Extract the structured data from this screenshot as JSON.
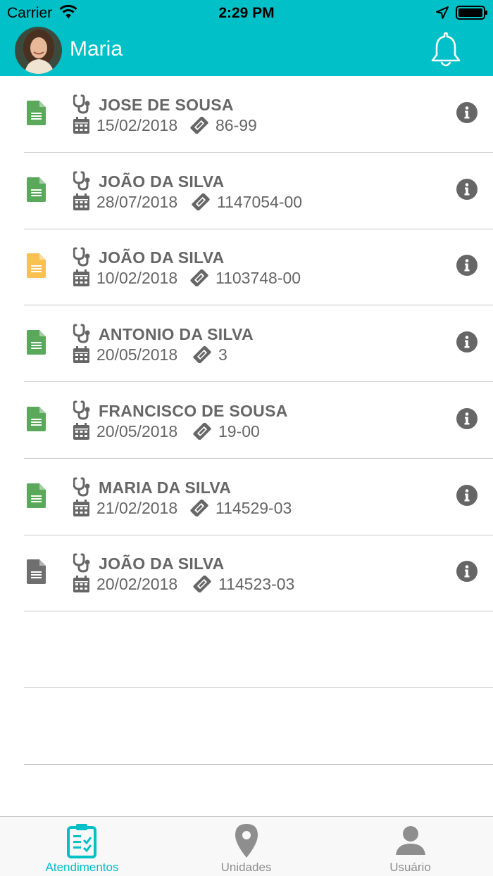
{
  "status_bar": {
    "carrier": "Carrier",
    "time": "2:29 PM"
  },
  "header": {
    "user_name": "Maria"
  },
  "records": [
    {
      "name": "JOSE DE SOUSA",
      "date": "15/02/2018",
      "code": "86-99",
      "doc_color": "#5aa85a"
    },
    {
      "name": "JOÃO DA SILVA",
      "date": "28/07/2018",
      "code": "1147054-00",
      "doc_color": "#5aa85a"
    },
    {
      "name": "JOÃO DA SILVA",
      "date": "10/02/2018",
      "code": "1103748-00",
      "doc_color": "#f9c150"
    },
    {
      "name": "ANTONIO DA SILVA",
      "date": "20/05/2018",
      "code": "3",
      "doc_color": "#5aa85a"
    },
    {
      "name": "FRANCISCO DE SOUSA",
      "date": "20/05/2018",
      "code": "19-00",
      "doc_color": "#5aa85a"
    },
    {
      "name": "MARIA DA SILVA",
      "date": "21/02/2018",
      "code": "114529-03",
      "doc_color": "#5aa85a"
    },
    {
      "name": "JOÃO DA SILVA",
      "date": "20/02/2018",
      "code": "114523-03",
      "doc_color": "#6f6f6f"
    }
  ],
  "tabs": [
    {
      "label": "Atendimentos",
      "icon": "clipboard-check-icon",
      "active": true
    },
    {
      "label": "Unidades",
      "icon": "map-marker-icon",
      "active": false
    },
    {
      "label": "Usuário",
      "icon": "user-icon",
      "active": false
    }
  ],
  "colors": {
    "primary": "#02c0c8",
    "text_gray": "#666666",
    "tab_inactive": "#8e8e8e"
  }
}
